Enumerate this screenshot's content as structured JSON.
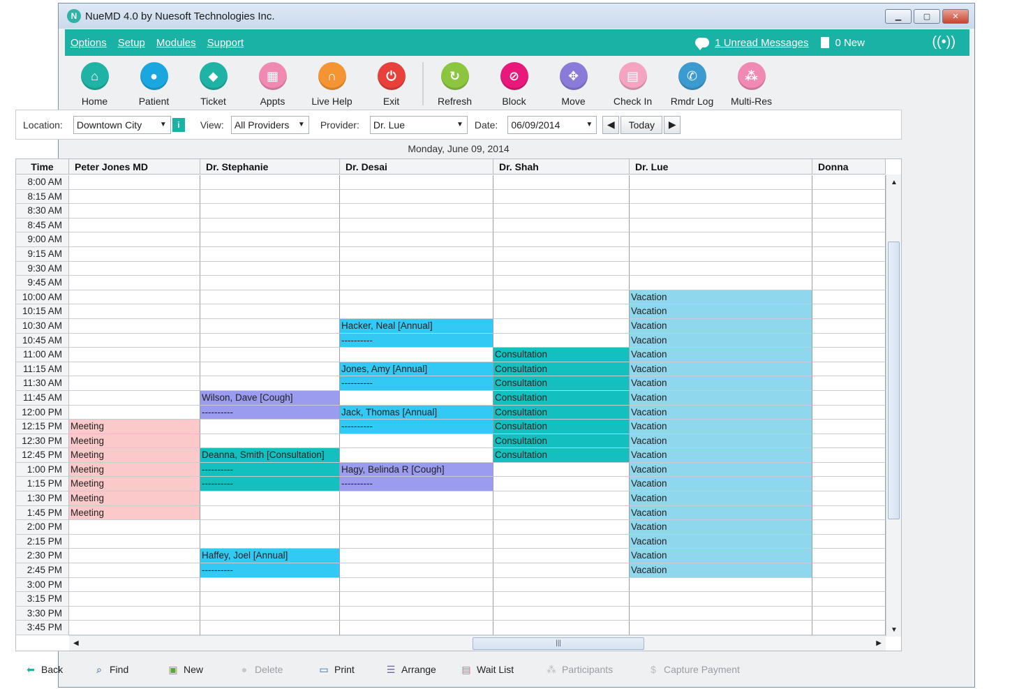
{
  "window": {
    "title": "NueMD 4.0 by Nuesoft Technologies Inc.",
    "logo": "N"
  },
  "menu": {
    "items": [
      "Options",
      "Setup",
      "Modules",
      "Support"
    ],
    "messages": "1 Unread Messages",
    "new_docs": "0 New"
  },
  "toolbar": [
    {
      "label": "Home",
      "icon": "home-icon",
      "color": "#1fb3a5",
      "glyph": "⌂"
    },
    {
      "label": "Patient",
      "icon": "person-icon",
      "color": "#1aa7e0",
      "glyph": "●"
    },
    {
      "label": "Ticket",
      "icon": "tag-icon",
      "color": "#1fb3a5",
      "glyph": "◆"
    },
    {
      "label": "Appts",
      "icon": "calendar-icon",
      "color": "#f08ab3",
      "glyph": "▦"
    },
    {
      "label": "Live Help",
      "icon": "headset-icon",
      "color": "#f59432",
      "glyph": "∩"
    },
    {
      "label": "Exit",
      "icon": "power-icon",
      "color": "#e8413c",
      "glyph": "⏻"
    },
    {
      "label": "Refresh",
      "icon": "refresh-icon",
      "color": "#8cc63f",
      "glyph": "↻"
    },
    {
      "label": "Block",
      "icon": "block-icon",
      "color": "#e8197a",
      "glyph": "⊘"
    },
    {
      "label": "Move",
      "icon": "move-icon",
      "color": "#8a7bd8",
      "glyph": "✥"
    },
    {
      "label": "Check In",
      "icon": "clipboard-icon",
      "color": "#f4a3c0",
      "glyph": "▤"
    },
    {
      "label": "Rmdr Log",
      "icon": "phone-icon",
      "color": "#3b9bd1",
      "glyph": "✆"
    },
    {
      "label": "Multi-Res",
      "icon": "group-icon",
      "color": "#f08ab3",
      "glyph": "⁂"
    }
  ],
  "filters": {
    "location_label": "Location:",
    "location_value": "Downtown City",
    "info": "i",
    "view_label": "View:",
    "view_value": "All Providers",
    "provider_label": "Provider:",
    "provider_value": "Dr. Lue",
    "date_label": "Date:",
    "date_value": "06/09/2014",
    "today": "Today"
  },
  "date_heading": "Monday, June 09, 2014",
  "schedule": {
    "time_header": "Time",
    "columns": [
      "Peter Jones MD",
      "Dr. Stephanie",
      "Dr. Desai",
      "Dr. Shah",
      "Dr. Lue",
      "Donna"
    ],
    "times": [
      "8:00 AM",
      "8:15 AM",
      "8:30 AM",
      "8:45 AM",
      "9:00 AM",
      "9:15 AM",
      "9:30 AM",
      "9:45 AM",
      "10:00 AM",
      "10:15 AM",
      "10:30 AM",
      "10:45 AM",
      "11:00 AM",
      "11:15 AM",
      "11:30 AM",
      "11:45 AM",
      "12:00 PM",
      "12:15 PM",
      "12:30 PM",
      "12:45 PM",
      "1:00 PM",
      "1:15 PM",
      "1:30 PM",
      "1:45 PM",
      "2:00 PM",
      "2:15 PM",
      "2:30 PM",
      "2:45 PM",
      "3:00 PM",
      "3:15 PM",
      "3:30 PM",
      "3:45 PM"
    ],
    "colors": {
      "meeting": "#fbc9c9",
      "annual": "#33c9f5",
      "cough": "#9b9bf0",
      "consultation": "#14bfbf",
      "vacation": "#8fd7ec"
    },
    "blocks": [
      {
        "col": 0,
        "start": 17,
        "labels": [
          "Meeting",
          "Meeting",
          "Meeting",
          "Meeting",
          "Meeting",
          "Meeting",
          "Meeting"
        ],
        "kind": "meeting"
      },
      {
        "col": 1,
        "start": 15,
        "labels": [
          "Wilson, Dave   [Cough]",
          "----------"
        ],
        "kind": "cough"
      },
      {
        "col": 1,
        "start": 19,
        "labels": [
          "Deanna, Smith   [Consultation]",
          "----------",
          "----------"
        ],
        "kind": "consultation"
      },
      {
        "col": 1,
        "start": 26,
        "labels": [
          "Haffey, Joel   [Annual]",
          "----------"
        ],
        "kind": "annual"
      },
      {
        "col": 2,
        "start": 10,
        "labels": [
          "Hacker, Neal   [Annual]",
          "----------"
        ],
        "kind": "annual"
      },
      {
        "col": 2,
        "start": 13,
        "labels": [
          "Jones, Amy   [Annual]",
          "----------"
        ],
        "kind": "annual"
      },
      {
        "col": 2,
        "start": 16,
        "labels": [
          "Jack, Thomas   [Annual]",
          "----------"
        ],
        "kind": "annual"
      },
      {
        "col": 2,
        "start": 20,
        "labels": [
          "Hagy, Belinda R   [Cough]",
          "----------"
        ],
        "kind": "cough"
      },
      {
        "col": 3,
        "start": 12,
        "labels": [
          "Consultation",
          "Consultation",
          "Consultation",
          "Consultation",
          "Consultation",
          "Consultation",
          "Consultation",
          "Consultation"
        ],
        "kind": "consultation"
      },
      {
        "col": 4,
        "start": 8,
        "labels": [
          "Vacation",
          "Vacation",
          "Vacation",
          "Vacation",
          "Vacation",
          "Vacation",
          "Vacation",
          "Vacation",
          "Vacation",
          "Vacation",
          "Vacation",
          "Vacation",
          "Vacation",
          "Vacation",
          "Vacation",
          "Vacation",
          "Vacation",
          "Vacation",
          "Vacation",
          "Vacation"
        ],
        "kind": "vacation"
      }
    ]
  },
  "bottom": [
    {
      "label": "Back",
      "icon": "back-arrow-icon",
      "glyph": "⬅",
      "color": "#19b2a4",
      "enabled": true
    },
    {
      "label": "Find",
      "icon": "magnifier-icon",
      "glyph": "⌕",
      "color": "#1a4c8c",
      "enabled": true
    },
    {
      "label": "New",
      "icon": "new-doc-icon",
      "glyph": "▣",
      "color": "#58a83a",
      "enabled": true
    },
    {
      "label": "Delete",
      "icon": "delete-icon",
      "glyph": "●",
      "color": "#c4c7cb",
      "enabled": false
    },
    {
      "label": "Print",
      "icon": "printer-icon",
      "glyph": "▭",
      "color": "#1a6cc0",
      "enabled": true
    },
    {
      "label": "Arrange",
      "icon": "arrange-icon",
      "glyph": "☰",
      "color": "#6a5fb0",
      "enabled": true
    },
    {
      "label": "Wait List",
      "icon": "list-icon",
      "glyph": "▤",
      "color": "#e0608c",
      "enabled": true
    },
    {
      "label": "Participants",
      "icon": "participants-icon",
      "glyph": "⁂",
      "color": "#b9bcc0",
      "enabled": false
    },
    {
      "label": "Capture Payment",
      "icon": "dollar-icon",
      "glyph": "$",
      "color": "#b9bcc0",
      "enabled": false
    }
  ]
}
